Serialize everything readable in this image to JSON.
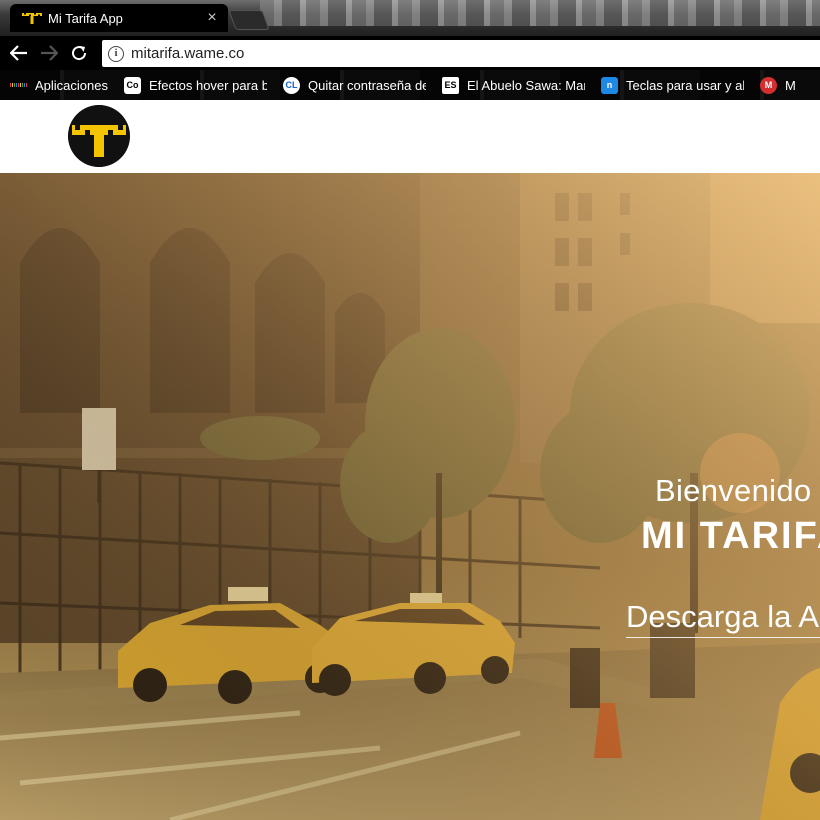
{
  "browser": {
    "tab": {
      "title": "Mi Tarifa App",
      "close_glyph": "×",
      "favicon": "taxi-logo-icon"
    },
    "omnibox": {
      "url": "mitarifa.wame.co",
      "info_glyph": "i"
    },
    "bookmarks": [
      {
        "label": "Aplicaciones",
        "icon": "apps-grid-icon"
      },
      {
        "label": "Efectos hover para bo",
        "icon": "codrops-icon"
      },
      {
        "label": "Quitar contraseña de",
        "icon": "cl-icon"
      },
      {
        "label": "El Abuelo Sawa: Man",
        "icon": "sawa-icon"
      },
      {
        "label": "Teclas para usar y ab",
        "icon": "n-icon"
      },
      {
        "label": "M",
        "icon": "mega-icon"
      }
    ]
  },
  "hero": {
    "welcome": "Bienvenido a",
    "brand": "MI TARIFA",
    "download": "Descarga la App"
  },
  "colors": {
    "taxi_yellow": "#f5c400",
    "overlay_tint": "#8f713e",
    "chrome_black": "#000000"
  }
}
